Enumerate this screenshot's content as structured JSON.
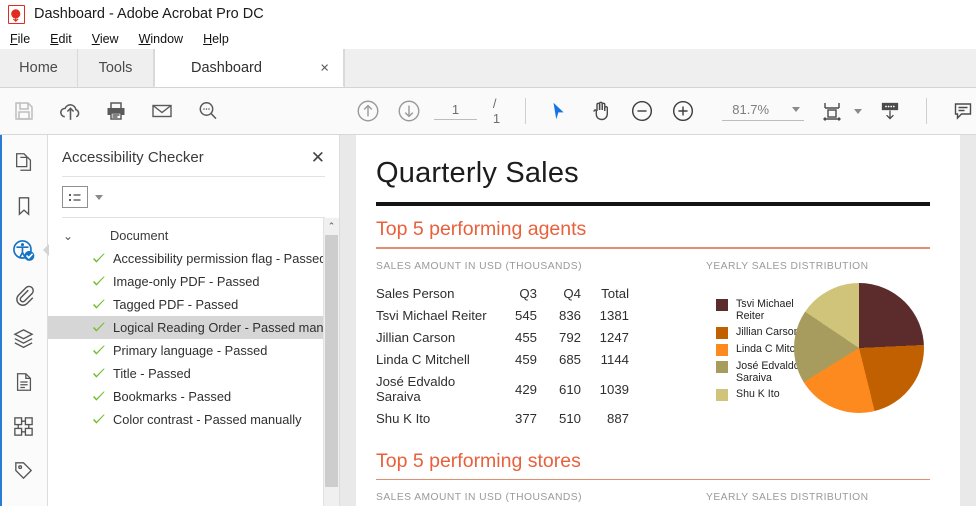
{
  "window": {
    "title": "Dashboard - Adobe Acrobat Pro DC",
    "app_icon": "pdf-document-icon"
  },
  "menubar": {
    "items": [
      {
        "label": "File",
        "accel": "F"
      },
      {
        "label": "Edit",
        "accel": "E"
      },
      {
        "label": "View",
        "accel": "V"
      },
      {
        "label": "Window",
        "accel": "W"
      },
      {
        "label": "Help",
        "accel": "H"
      }
    ]
  },
  "tabs": {
    "home": "Home",
    "tools": "Tools",
    "document": "Dashboard",
    "close_glyph": "×",
    "active": "Dashboard"
  },
  "toolbar": {
    "left_icons": [
      "save-icon",
      "cloud-upload-icon",
      "print-icon",
      "email-icon",
      "search-icon"
    ],
    "save_enabled": false,
    "page_current": "1",
    "page_total": "/ 1",
    "tools": [
      "select-tool-icon",
      "hand-tool-icon",
      "zoom-out-icon",
      "zoom-in-icon"
    ],
    "active_tool": "select-tool-icon",
    "zoom_level": "81.7%",
    "right_icons": [
      "fit-page-icon",
      "scroll-mode-icon",
      "comment-icon"
    ]
  },
  "rail": {
    "items": [
      {
        "name": "page-thumbnails-icon",
        "active": false
      },
      {
        "name": "bookmarks-icon",
        "active": false
      },
      {
        "name": "accessibility-icon",
        "active": true
      },
      {
        "name": "attachments-icon",
        "active": false
      },
      {
        "name": "layers-icon",
        "active": false
      },
      {
        "name": "content-icon",
        "active": false
      },
      {
        "name": "reading-order-icon",
        "active": false
      },
      {
        "name": "tags-icon",
        "active": false
      }
    ]
  },
  "panel": {
    "title": "Accessibility Checker",
    "close_glyph": "✕",
    "options_icon": "options-list-icon",
    "group": {
      "label": "Document",
      "expanded": true,
      "chevron": "⌄"
    },
    "items": [
      {
        "label": "Accessibility permission flag - Passed",
        "status": "passed",
        "selected": false
      },
      {
        "label": "Image-only PDF - Passed",
        "status": "passed",
        "selected": false
      },
      {
        "label": "Tagged PDF - Passed",
        "status": "passed",
        "selected": false
      },
      {
        "label": "Logical Reading Order - Passed manually",
        "status": "passed",
        "selected": true
      },
      {
        "label": "Primary language - Passed",
        "status": "passed",
        "selected": false
      },
      {
        "label": "Title - Passed",
        "status": "passed",
        "selected": false
      },
      {
        "label": "Bookmarks - Passed",
        "status": "passed",
        "selected": false
      },
      {
        "label": "Color contrast - Passed manually",
        "status": "passed",
        "selected": false
      }
    ],
    "scrollbar": {
      "up_glyph": "⌃"
    }
  },
  "document": {
    "title": "Quarterly Sales",
    "section1": {
      "heading": "Top 5 performing agents",
      "table_label": "SALES AMOUNT IN USD (THOUSANDS)",
      "chart_label": "YEARLY SALES DISTRIBUTION"
    },
    "section2": {
      "heading": "Top 5 performing stores",
      "table_label": "SALES AMOUNT IN USD (THOUSANDS)",
      "chart_label": "YEARLY SALES DISTRIBUTION"
    },
    "accent_color": "#e8613c",
    "table": {
      "headers": [
        "Sales Person",
        "Q3",
        "Q4",
        "Total"
      ],
      "rows": [
        {
          "name": "Tsvi Michael Reiter",
          "q3": "545",
          "q4": "836",
          "total": "1381"
        },
        {
          "name": "Jillian  Carson",
          "q3": "455",
          "q4": "792",
          "total": "1247"
        },
        {
          "name": "Linda C Mitchell",
          "q3": "459",
          "q4": "685",
          "total": "1144"
        },
        {
          "name": "José Edvaldo Saraiva",
          "q3": "429",
          "q4": "610",
          "total": "1039"
        },
        {
          "name": "Shu K Ito",
          "q3": "377",
          "q4": "510",
          "total": "887"
        }
      ]
    }
  },
  "chart_data": {
    "type": "pie",
    "title": "YEARLY SALES DISTRIBUTION",
    "categories": [
      "Tsvi Michael Reiter",
      "Jillian  Carson",
      "Linda C Mitchell",
      "José Edvaldo Saraiva",
      "Shu K Ito"
    ],
    "values": [
      1381,
      1247,
      1144,
      1039,
      887
    ],
    "percentages": [
      24.6,
      22.2,
      20.4,
      18.5,
      15.8
    ],
    "colors": [
      "#5c2b2b",
      "#c06000",
      "#fc8a1e",
      "#a89b5e",
      "#cfc479"
    ],
    "legend_position": "left",
    "start_angle_deg": 0,
    "direction": "clockwise"
  }
}
